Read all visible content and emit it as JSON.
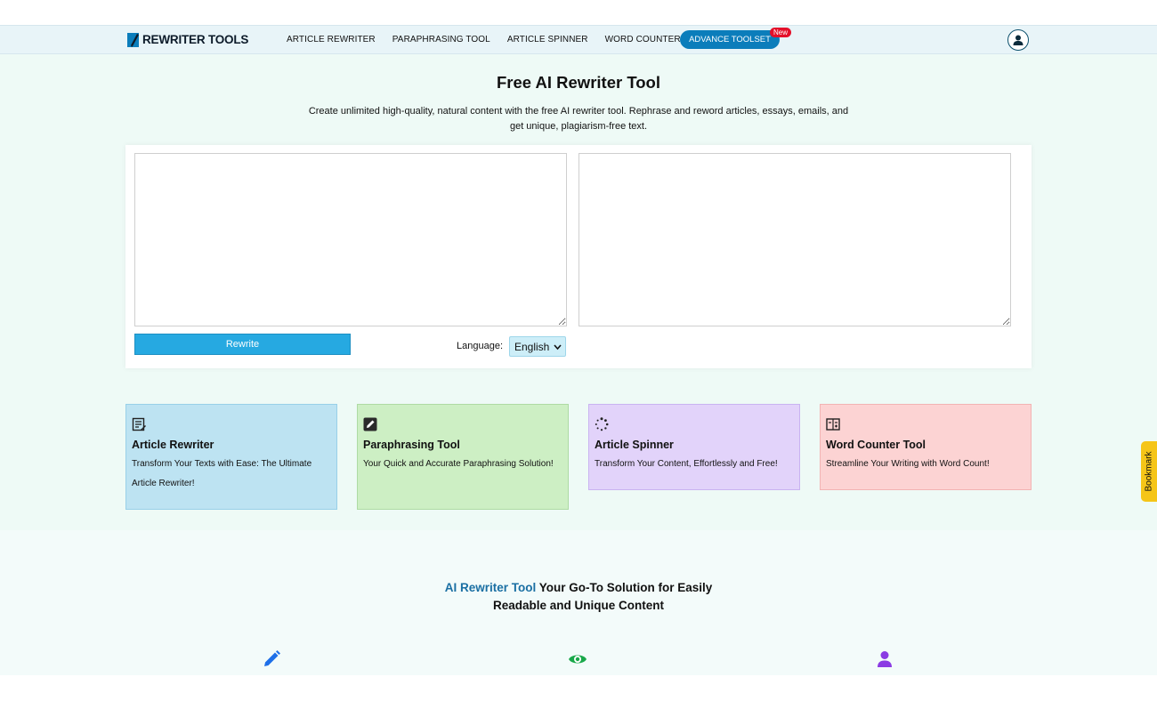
{
  "nav": {
    "logo": "REWRITER TOOLS",
    "links": [
      "ARTICLE REWRITER",
      "PARAPHRASING TOOL",
      "ARTICLE SPINNER",
      "WORD COUNTER"
    ],
    "advance_button": "ADVANCE TOOLSET",
    "new_badge": "New"
  },
  "hero": {
    "title": "Free AI Rewriter Tool",
    "subtitle": "Create unlimited high-quality, natural content with the free AI rewriter tool. Rephrase and reword articles, essays, emails, and get unique, plagiarism-free text."
  },
  "tool": {
    "input_value": "",
    "output_value": "",
    "rewrite_label": "Rewrite",
    "language_label": "Language:",
    "language_selected": "English"
  },
  "features": [
    {
      "title": "Article Rewriter",
      "desc": "Transform Your Texts with Ease: The Ultimate Article Rewriter!",
      "bg": "#bde3f2",
      "border": "#98d0e8",
      "icon": "notepad-icon"
    },
    {
      "title": "Paraphrasing Tool",
      "desc": "Your Quick and Accurate Paraphrasing Solution!",
      "bg": "#cdefc4",
      "border": "#aedba4",
      "icon": "edit-square-icon"
    },
    {
      "title": "Article Spinner",
      "desc": "Transform Your Content, Effortlessly and Free!",
      "bg": "#e2d3fa",
      "border": "#c9b3f1",
      "icon": "spinner-icon"
    },
    {
      "title": "Word Counter Tool",
      "desc": "Streamline Your Writing with Word Count!",
      "bg": "#fcd3d3",
      "border": "#f2b3b3",
      "icon": "calculator-icon"
    }
  ],
  "bookmark": "Bookmark",
  "lower": {
    "heading_highlight": "AI Rewriter Tool",
    "heading_rest": " Your Go-To Solution for Easily Readable and Unique Content"
  },
  "lower_icons": [
    {
      "name": "pencil-icon",
      "color": "#1e6fe8"
    },
    {
      "name": "eye-icon",
      "color": "#19a84a"
    },
    {
      "name": "person-icon",
      "color": "#8b3be3"
    }
  ],
  "colors": {
    "accent": "#0b7dbb",
    "rewrite_button": "#26a9e1",
    "new_badge": "#e4102a",
    "bookmark": "#f5c518"
  }
}
